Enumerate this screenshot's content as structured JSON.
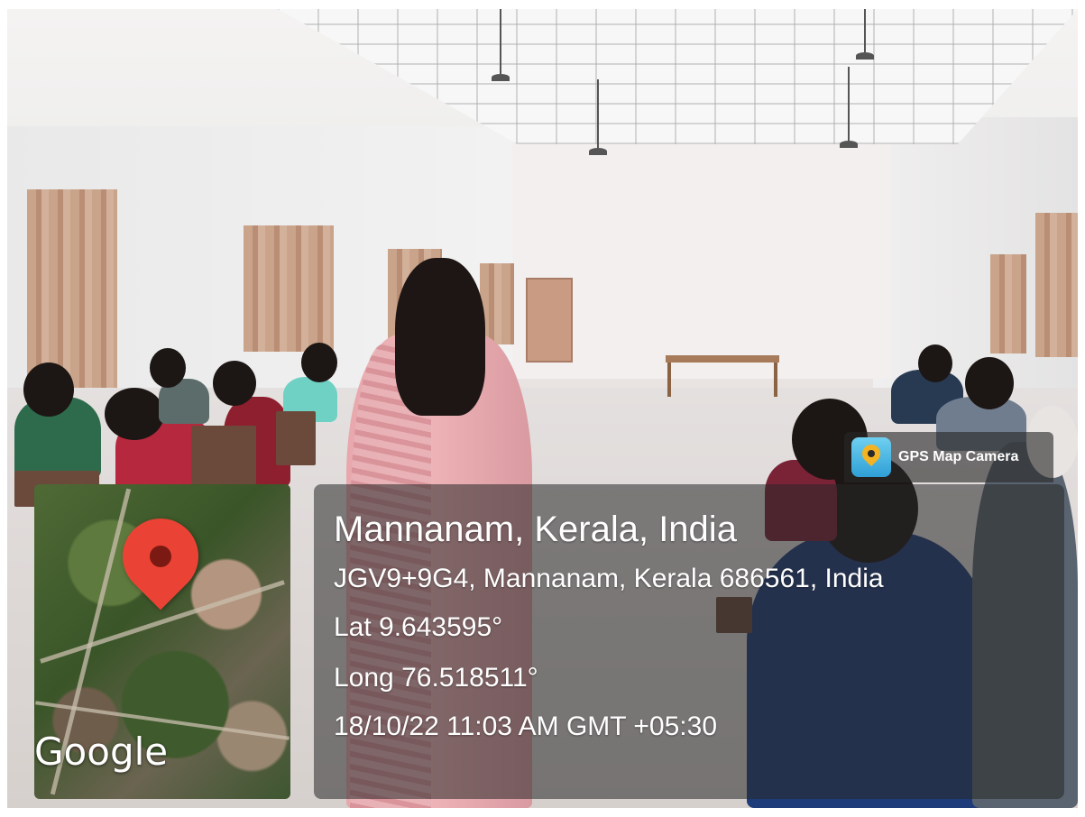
{
  "photo": {
    "subject": "classroom-exam-hall"
  },
  "gps_overlay": {
    "brand": {
      "icon": "gps-map-camera-icon",
      "label": "GPS Map Camera"
    },
    "place": "Mannanam, Kerala, India",
    "address": "JGV9+9G4, Mannanam, Kerala 686561, India",
    "latitude": "Lat 9.643595°",
    "longitude": "Long 76.518511°",
    "timestamp": "18/10/22 11:03 AM GMT +05:30",
    "map": {
      "pin_icon": "map-pin-icon",
      "attribution": "Google"
    }
  }
}
